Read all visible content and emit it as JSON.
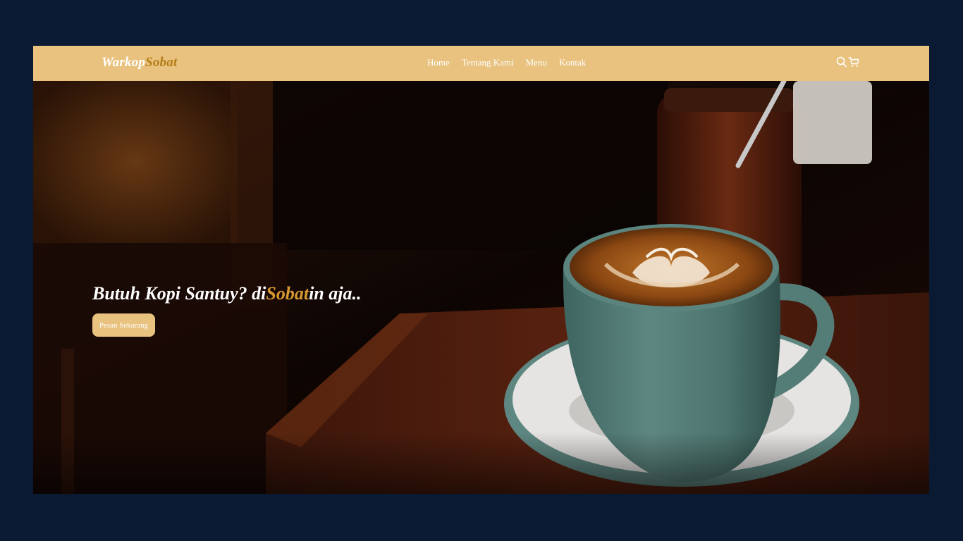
{
  "brand": {
    "name_main": "Warkop",
    "name_accent": "Sobat"
  },
  "nav": {
    "items": [
      "Home",
      "Tentang Kami",
      "Menu",
      "Kontak"
    ]
  },
  "icons": {
    "search": "search-icon",
    "cart": "cart-icon"
  },
  "hero": {
    "headline_pre": "Butuh Kopi Santuy? di",
    "headline_accent": "Sobat",
    "headline_post": "in aja..",
    "cta_label": "Pesan Sekarang"
  },
  "colors": {
    "page_background": "#0b1a33",
    "navbar": "#e8c27e",
    "brand_accent": "#b47d16",
    "headline_accent": "#d89a32",
    "button": "#e8c27e"
  }
}
